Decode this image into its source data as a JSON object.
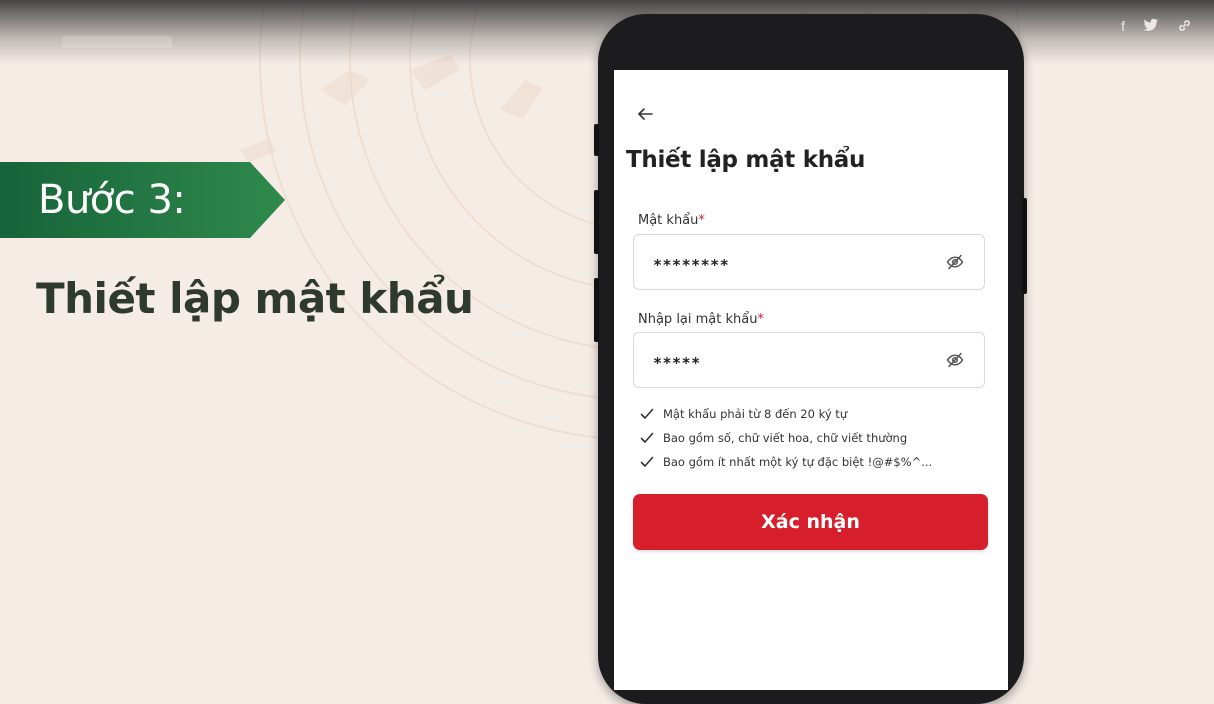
{
  "slide": {
    "step_label": "Bước 3:",
    "step_title": "Thiết lập mật khẩu",
    "social": [
      "f",
      "t",
      "link"
    ]
  },
  "colors": {
    "banner_green": "#1f6e3e",
    "confirm_red": "#d61f2b",
    "background": "#f6ece6",
    "title_dark": "#2f3a2f"
  },
  "screen": {
    "back_icon": "back-arrow-icon",
    "title": "Thiết lập mật khẩu",
    "password": {
      "label": "Mật khẩu",
      "required_mark": "*",
      "value": "********",
      "toggle_icon": "eye-slash-icon"
    },
    "confirm_password": {
      "label": "Nhập lại mật khẩu",
      "required_mark": "*",
      "value": "*****",
      "toggle_icon": "eye-slash-icon"
    },
    "rules": [
      "Mật khẩu phải từ 8 đến 20 ký tự",
      "Bao gồm số, chữ viết hoa, chữ viết thường",
      "Bao gồm ít nhất một ký tự đặc biệt !@#$%^..."
    ],
    "confirm_label": "Xác nhận"
  }
}
